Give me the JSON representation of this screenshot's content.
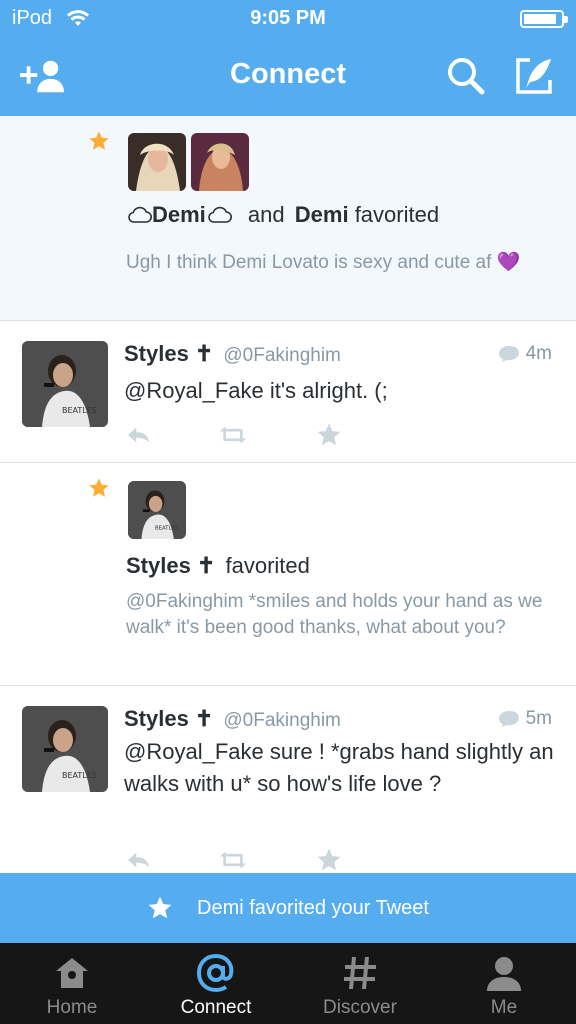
{
  "status_bar": {
    "carrier": "iPod",
    "time": "9:05 PM",
    "battery_level": 0.9
  },
  "nav": {
    "title": "Connect"
  },
  "feed": {
    "items": [
      {
        "type": "favorite-group",
        "actor1": "Demi",
        "joiner": "and",
        "actor2": "Demi",
        "verb": "favorited",
        "tweet_preview": "Ugh I think Demi Lovato is sexy and cute af 💜"
      },
      {
        "type": "tweet",
        "name": "Styles ✝",
        "handle": "@0Fakinghim",
        "time": "4m",
        "text": "@Royal_Fake it's alright. (;"
      },
      {
        "type": "favorite",
        "actor": "Styles ✝",
        "verb": "favorited",
        "tweet_preview": "@0Fakinghim *smiles and holds your hand as we walk* it's been good thanks, what about you?"
      },
      {
        "type": "tweet",
        "name": "Styles ✝",
        "handle": "@0Fakinghim",
        "time": "5m",
        "text": "@Royal_Fake sure ! *grabs hand slightly an walks with u* so how's life love ?"
      }
    ]
  },
  "toast": {
    "text": "Demi favorited your Tweet"
  },
  "tabs": [
    {
      "label": "Home",
      "icon": "home-icon"
    },
    {
      "label": "Connect",
      "icon": "at-icon",
      "active": true
    },
    {
      "label": "Discover",
      "icon": "hashtag-icon"
    },
    {
      "label": "Me",
      "icon": "person-icon"
    }
  ],
  "colors": {
    "brand": "#55acee",
    "star": "#ffac33",
    "muted": "#8899a6",
    "action": "#ccd6dd"
  }
}
